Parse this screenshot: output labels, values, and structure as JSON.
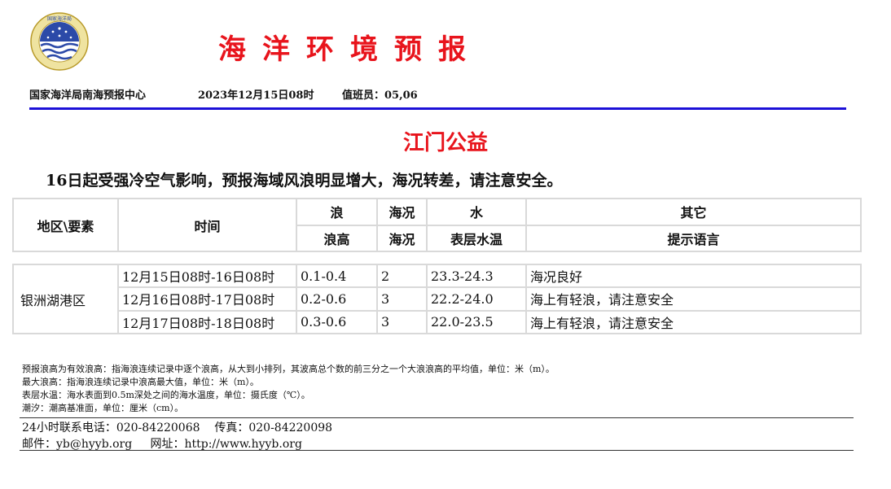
{
  "header": {
    "logo_icon": "soa-emblem",
    "logo_text": "国家海洋局",
    "title": "海洋环境预报",
    "org": "国家海洋局南海预报中心",
    "datetime": "2023年12月15日08时",
    "duty": "值班员：05,06"
  },
  "colors": {
    "title": "#e8141c",
    "rule": "#1c10d8"
  },
  "region_title": "江门公益",
  "headline": "16日起受强冷空气影响，预报海域风浪明显增大，海况转差，请注意安全。",
  "table_header": {
    "area": "地区\\要素",
    "time": "时间",
    "wave_group": "浪",
    "sea_group": "海况",
    "water_group": "水",
    "other_group": "其它",
    "wave_sub": "浪高",
    "sea_sub": "海况",
    "water_sub": "表层水温",
    "other_sub": "提示语言"
  },
  "area_name": "银洲湖港区",
  "rows": [
    {
      "time": "12月15日08时-16日08时",
      "wave": "0.1-0.4",
      "sea": "2",
      "temp": "23.3-24.3",
      "tip": "海况良好"
    },
    {
      "time": "12月16日08时-17日08时",
      "wave": "0.2-0.6",
      "sea": "3",
      "temp": "22.2-24.0",
      "tip": "海上有轻浪，请注意安全"
    },
    {
      "time": "12月17日08时-18日08时",
      "wave": "0.3-0.6",
      "sea": "3",
      "temp": "22.0-23.5",
      "tip": "海上有轻浪，请注意安全"
    }
  ],
  "notes": [
    "预报浪高为有效浪高：指海浪连续记录中逐个浪高，从大到小排列，其波高总个数的前三分之一个大浪浪高的平均值，单位：米（m）。",
    "最大浪高：指海浪连续记录中浪高最大值，单位：米（m）。",
    "表层水温：海水表面到0.5m深处之间的海水温度，单位：摄氏度（℃）。",
    "潮汐：潮高基准面，单位：厘米（cm）。"
  ],
  "contact": {
    "phone": "24小时联系电话：020-84220068",
    "fax": "传真：020-84220098",
    "email": "邮件：yb@hyyb.org",
    "web": "网址：http://www.hyyb.org"
  }
}
